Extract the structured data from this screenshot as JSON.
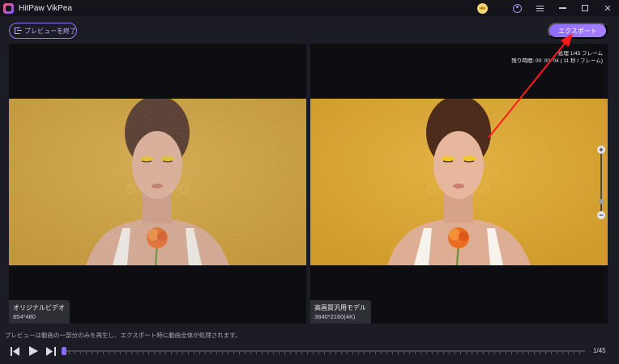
{
  "window": {
    "title": "HitPaw VikPea"
  },
  "toolbar": {
    "exit_preview_label": "プレビューを終了",
    "export_label": "エクスポート"
  },
  "left_pane": {
    "model_label": "オリジナルビデオ",
    "resolution": "854*480"
  },
  "right_pane": {
    "model_label": "高画質汎用モデル",
    "resolution": "3840*2160(4K)",
    "processing_line": "処理 1/45 フレーム",
    "time_line": "残り時間: 00: 00: 04 ( 11 秒 / フレーム)"
  },
  "bottom": {
    "hint": "プレビューは動画の一部分のみを再生し、エクスポート時に動画全体が処理されます。",
    "frame_counter": "1/45",
    "progress": 0.0
  },
  "zoom": {
    "plus_label": "+",
    "minus_label": "−",
    "level": 0.15
  },
  "icons": {
    "app": "app-logo-icon",
    "premium": "crown-icon",
    "account": "user-icon",
    "menu": "menu-icon",
    "minimize": "minimize-icon",
    "maximize": "maximize-icon",
    "close": "close-icon",
    "exit_preview": "exit-preview-icon",
    "prev_frame": "prev-frame-icon",
    "play": "play-icon",
    "next_frame": "next-frame-icon"
  },
  "colors": {
    "accent": "#8f6bff",
    "annotation": "#ff1a1a",
    "background_mustard": "#d9a63a"
  }
}
